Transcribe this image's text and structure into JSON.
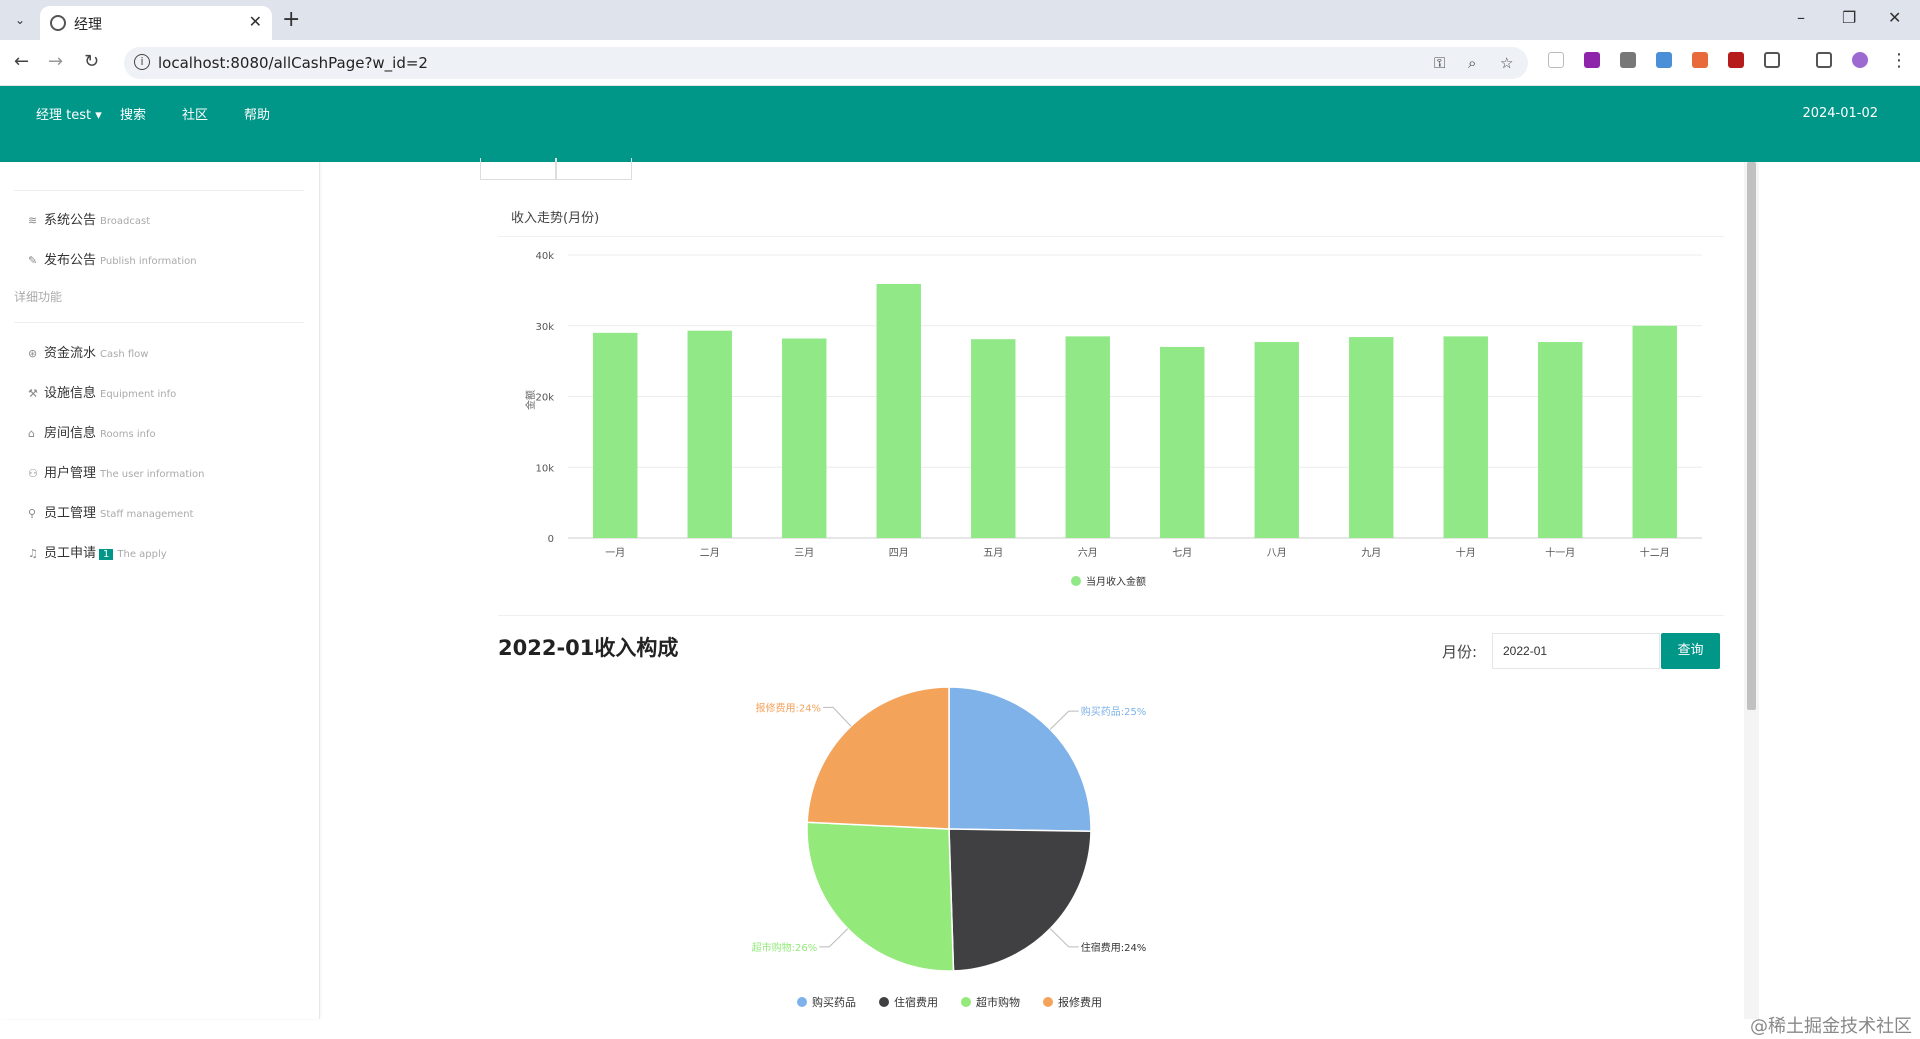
{
  "browser": {
    "tab_title": "经理",
    "url": "localhost:8080/allCashPage?w_id=2"
  },
  "header": {
    "nav": [
      "经理 test",
      "搜索",
      "社区",
      "帮助"
    ],
    "date": "2024-01-02"
  },
  "sidebar": {
    "sections": [
      {
        "title": "详细功能"
      }
    ],
    "items": [
      {
        "label": "系统公告",
        "en": "Broadcast",
        "icon": "broadcast-icon"
      },
      {
        "label": "发布公告",
        "en": "Publish information",
        "icon": "edit-icon"
      },
      {
        "label": "资金流水",
        "en": "Cash flow",
        "icon": "cash-icon"
      },
      {
        "label": "设施信息",
        "en": "Equipment info",
        "icon": "equipment-icon"
      },
      {
        "label": "房间信息",
        "en": "Rooms info",
        "icon": "home-icon"
      },
      {
        "label": "用户管理",
        "en": "The user information",
        "icon": "user-icon"
      },
      {
        "label": "员工管理",
        "en": "Staff management",
        "icon": "staff-icon"
      },
      {
        "label": "员工申请",
        "en": "The apply",
        "icon": "bell-icon",
        "badge": "1"
      }
    ]
  },
  "main": {
    "bar_title": "收入走势(月份)",
    "pie_title": "2022-01收入构成",
    "month_label": "月份:",
    "month_value": "2022-01",
    "query_label": "查询"
  },
  "chart_data": [
    {
      "type": "bar",
      "title": "收入走势(月份)",
      "ylabel": "金额",
      "categories": [
        "一月",
        "二月",
        "三月",
        "四月",
        "五月",
        "六月",
        "七月",
        "八月",
        "九月",
        "十月",
        "十一月",
        "十二月"
      ],
      "series": [
        {
          "name": "当月收入金额",
          "values": [
            29000,
            29300,
            28200,
            35900,
            28100,
            28500,
            27000,
            27700,
            28400,
            28500,
            27700,
            30000
          ],
          "color": "#90e986"
        }
      ],
      "ylim": [
        0,
        40000
      ],
      "yticks": [
        "0",
        "10k",
        "20k",
        "30k",
        "40k"
      ],
      "grid": true,
      "legend": "bottom"
    },
    {
      "type": "pie",
      "title": "2022-01收入构成",
      "slices": [
        {
          "name": "购买药品",
          "value": 25,
          "label": "购买药品:25%",
          "color": "#7eb2e8"
        },
        {
          "name": "住宿费用",
          "value": 24,
          "label": "住宿费用:24%",
          "color": "#404043"
        },
        {
          "name": "超市购物",
          "value": 26,
          "label": "超市购物:26%",
          "color": "#93e97a"
        },
        {
          "name": "报修费用",
          "value": 24,
          "label": "报修费用:24%",
          "color": "#f4a35b"
        }
      ],
      "legend": "bottom"
    }
  ],
  "watermark": "@稀土掘金技术社区"
}
